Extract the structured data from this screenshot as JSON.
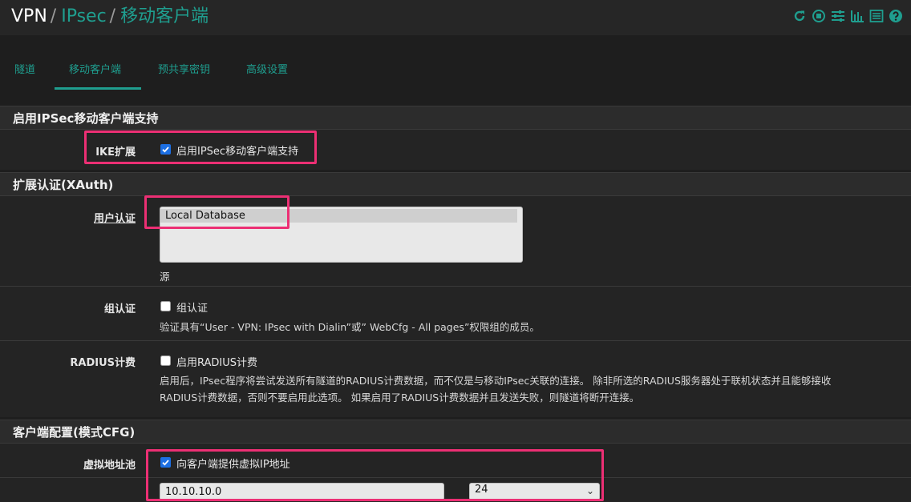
{
  "breadcrumb": {
    "root": "VPN",
    "level2": "IPsec",
    "current": "移动客户端",
    "sep": "/"
  },
  "header_icons": [
    "reload-icon",
    "stop-icon",
    "sliders-icon",
    "chart-icon",
    "list-icon",
    "help-icon"
  ],
  "tabs": [
    {
      "label": "隧道"
    },
    {
      "label": "移动客户端",
      "active": true
    },
    {
      "label": "预共享密钥"
    },
    {
      "label": "高级设置"
    }
  ],
  "sections": {
    "s1": {
      "title": "启用IPSec移动客户端支持"
    },
    "s2": {
      "title": "扩展认证(XAuth)"
    },
    "s3": {
      "title": "客户端配置(模式CFG)"
    }
  },
  "ike": {
    "label": "IKE扩展",
    "checkbox_label": "启用IPSec移动客户端支持",
    "checked": true
  },
  "user_auth": {
    "label": "用户认证",
    "options": [
      "Local Database"
    ],
    "source_label": "源"
  },
  "group_auth": {
    "label": "组认证",
    "checkbox_label": "组认证",
    "checked": false,
    "help": "验证具有“User - VPN: IPsec with Dialin”或” WebCfg - All pages”权限组的成员。"
  },
  "radius": {
    "label": "RADIUS计费",
    "checkbox_label": "启用RADIUS计费",
    "checked": false,
    "help_line1": "启用后，IPsec程序将尝试发送所有隧道的RADIUS计费数据，而不仅是与移动IPsec关联的连接。 除非所选的RADIUS服务器处于联机状态并且能够接收",
    "help_line2": "RADIUS计费数据，否则不要启用此选项。 如果启用了RADIUS计费数据并且发送失败，则隧道将断开连接。"
  },
  "pool": {
    "label": "虚拟地址池",
    "checkbox_label": "向客户端提供虚拟IP地址",
    "checked": true,
    "ip_value": "10.10.10.0",
    "mask_value": "24"
  },
  "colors": {
    "accent": "#1f9e8f",
    "highlight": "#ec2f74"
  }
}
